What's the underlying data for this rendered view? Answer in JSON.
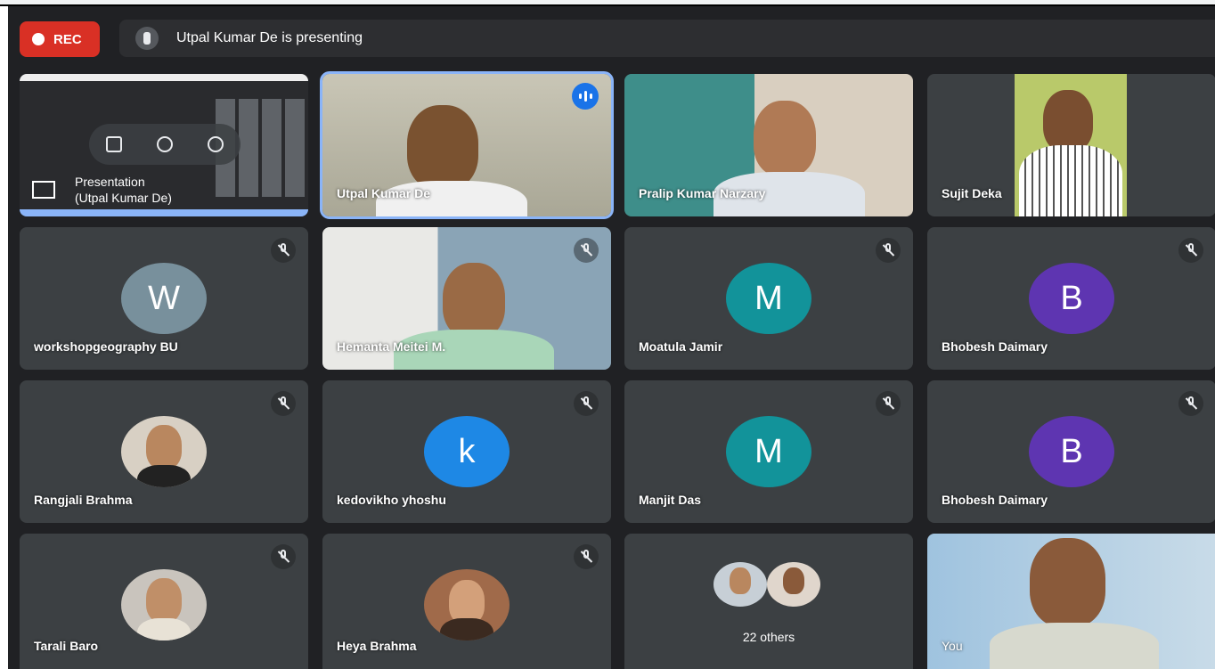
{
  "recording": {
    "label": "REC"
  },
  "presenter_bar": {
    "text": "Utpal Kumar De is presenting"
  },
  "colors": {
    "background": "#202124",
    "tile": "#3c4043",
    "rec": "#d93025",
    "speaking_border": "#8ab4f8"
  },
  "presentation_tile": {
    "line1": "Presentation",
    "line2": "(Utpal Kumar De)"
  },
  "participants": {
    "utpal": {
      "name": "Utpal Kumar De"
    },
    "pralip": {
      "name": "Pralip Kumar Narzary"
    },
    "sujit": {
      "name": "Sujit Deka"
    },
    "workshop": {
      "name": "workshopgeography BU",
      "initial": "W",
      "avatar_color": "#78909c"
    },
    "hemanta": {
      "name": "Hemanta Meitei M."
    },
    "moatula": {
      "name": "Moatula Jamir",
      "initial": "M",
      "avatar_color": "#12939a"
    },
    "bhobesh1": {
      "name": "Bhobesh Daimary",
      "initial": "B",
      "avatar_color": "#5e35b1"
    },
    "rangjali": {
      "name": "Rangjali Brahma"
    },
    "kedovikho": {
      "name": "kedovikho yhoshu",
      "initial": "k",
      "avatar_color": "#1e88e5"
    },
    "manjit": {
      "name": "Manjit Das",
      "initial": "M",
      "avatar_color": "#12939a"
    },
    "bhobesh2": {
      "name": "Bhobesh Daimary",
      "initial": "B",
      "avatar_color": "#5e35b1"
    },
    "tarali": {
      "name": "Tarali Baro"
    },
    "heya": {
      "name": "Heya Brahma"
    },
    "others": {
      "label": "22 others"
    },
    "you": {
      "name": "You"
    }
  },
  "icons": [
    "present-to-all-icon",
    "mic-off-icon",
    "speaking-indicator-icon",
    "pin-icon",
    "mute-icon",
    "remove-icon"
  ]
}
